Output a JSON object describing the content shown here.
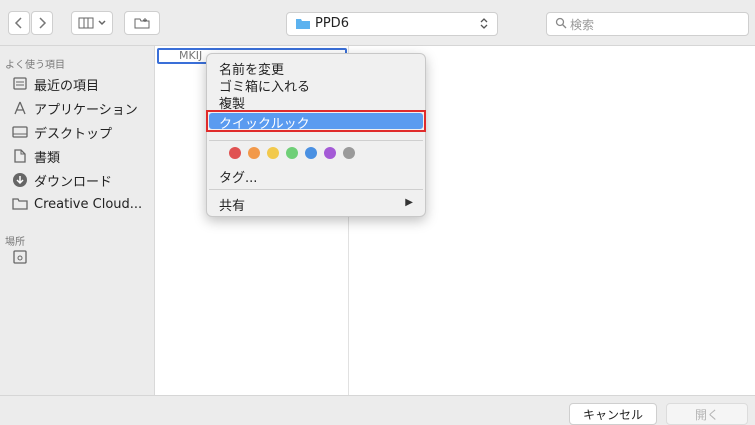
{
  "toolbar": {
    "path_folder": "PPD6",
    "search_placeholder": "検索"
  },
  "sidebar": {
    "favorites_header": "よく使う項目",
    "items": [
      {
        "label": "最近の項目",
        "icon": "recent-items-icon"
      },
      {
        "label": "アプリケーション",
        "icon": "applications-icon"
      },
      {
        "label": "デスクトップ",
        "icon": "desktop-icon"
      },
      {
        "label": "書類",
        "icon": "documents-icon"
      },
      {
        "label": "ダウンロード",
        "icon": "downloads-icon"
      },
      {
        "label": "Creative Cloud...",
        "icon": "folder-icon"
      }
    ],
    "locations_header": "場所"
  },
  "column1": {
    "selected_file": "MKIJ"
  },
  "context_menu": {
    "items": [
      "名前を変更",
      "ゴミ箱に入れる",
      "複製",
      "クイックルック"
    ],
    "highlight_color": "#5a9bf0",
    "tag_colors": [
      "#e05252",
      "#f2994a",
      "#f2c94c",
      "#6fcf77",
      "#4a90e2",
      "#a45ad6",
      "#9a9a9a"
    ],
    "tags_label": "タグ...",
    "share_label": "共有"
  },
  "bottom": {
    "cancel_label": "キャンセル",
    "open_label": "開く"
  }
}
